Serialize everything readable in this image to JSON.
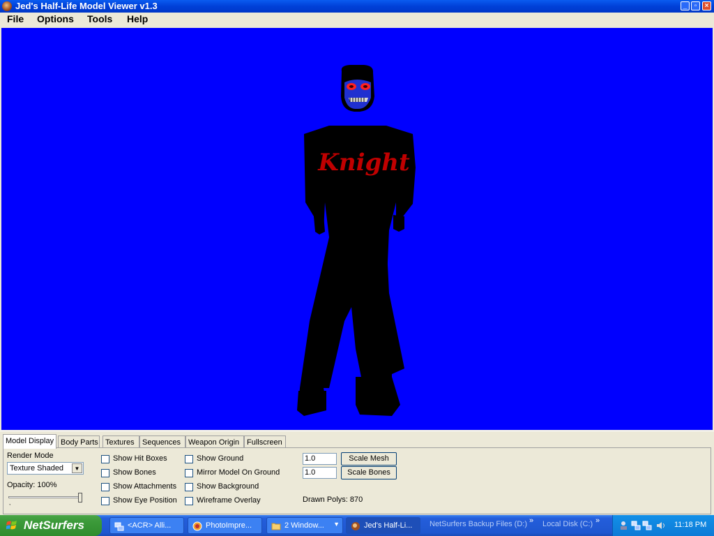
{
  "window": {
    "title": "Jed's Half-Life Model Viewer v1.3",
    "buttons": [
      "minimize",
      "restore",
      "close"
    ]
  },
  "menu": [
    "File",
    "Options",
    "Tools",
    "Help"
  ],
  "viewport": {
    "background": "#0000ff",
    "shirt_text": "Knight"
  },
  "tabs": [
    {
      "label": "Model Display",
      "active": true
    },
    {
      "label": "Body Parts"
    },
    {
      "label": "Textures"
    },
    {
      "label": "Sequences"
    },
    {
      "label": "Weapon Origin"
    },
    {
      "label": "Fullscreen"
    }
  ],
  "model_display": {
    "render_mode_label": "Render Mode",
    "render_mode_value": "Texture Shaded",
    "opacity_label": "Opacity: 100%",
    "opacity_level": 1.0,
    "checkboxes_col1": [
      {
        "label": "Show Hit Boxes",
        "checked": false
      },
      {
        "label": "Show Bones",
        "checked": false
      },
      {
        "label": "Show Attachments",
        "checked": false
      },
      {
        "label": "Show Eye Position",
        "checked": false
      }
    ],
    "checkboxes_col2": [
      {
        "label": "Show Ground",
        "checked": false
      },
      {
        "label": "Mirror Model On Ground",
        "checked": false
      },
      {
        "label": "Show Background",
        "checked": false
      },
      {
        "label": "Wireframe Overlay",
        "checked": false
      }
    ],
    "scale_mesh_value": "1.0",
    "scale_bones_value": "1.0",
    "scale_mesh_button": "Scale Mesh",
    "scale_bones_button": "Scale Bones",
    "drawn_polys": "Drawn Polys: 870"
  },
  "taskbar": {
    "start_label": "NetSurfers",
    "tasks": [
      {
        "label": "<ACR> Alli...",
        "icon": "network-icon"
      },
      {
        "label": "PhotoImpre...",
        "icon": "photoimpact-icon"
      },
      {
        "label": "2 Window...",
        "icon": "folder-icon"
      },
      {
        "label": "Jed's Half-Li...",
        "icon": "hlmv-icon",
        "active": true
      }
    ],
    "deskbars": [
      "NetSurfers Backup Files (D:)",
      "Local Disk (C:)"
    ],
    "clock": "11:18 PM"
  }
}
